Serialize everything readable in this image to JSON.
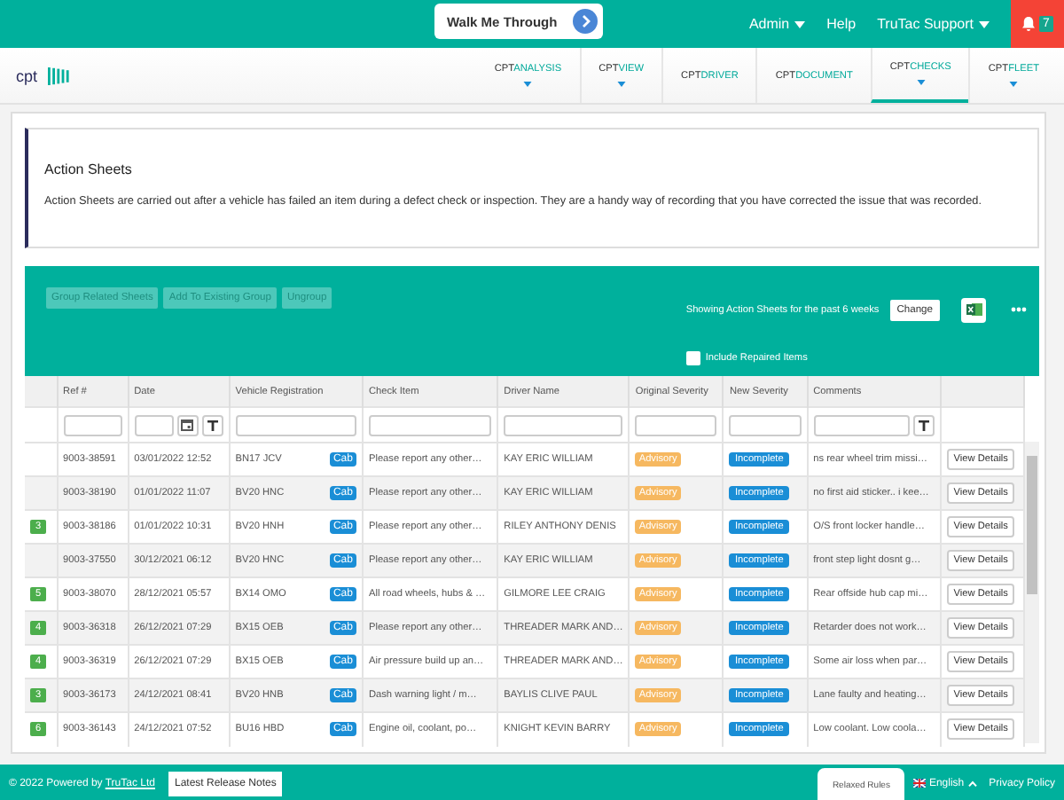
{
  "top_bar": {
    "tour_button": "Walk Me Through",
    "menus": [
      {
        "label": "Admin",
        "dropdown": true
      },
      {
        "label": "Help",
        "dropdown": false
      },
      {
        "label": "TruTac Support",
        "dropdown": true
      }
    ],
    "notifications": {
      "count": "7"
    }
  },
  "nav": {
    "logo": "cpt",
    "items": [
      {
        "prefix": "CPT",
        "name": "ANALYSIS",
        "dropdown": true,
        "selected": false
      },
      {
        "prefix": "CPT",
        "name": "VIEW",
        "dropdown": true,
        "selected": false
      },
      {
        "prefix": "CPT",
        "name": "DRIVER",
        "dropdown": false,
        "selected": false
      },
      {
        "prefix": "CPT",
        "name": "DOCUMENT",
        "dropdown": false,
        "selected": false
      },
      {
        "prefix": "CPT",
        "name": "CHECKS",
        "dropdown": true,
        "selected": true
      },
      {
        "prefix": "CPT",
        "name": "FLEET",
        "dropdown": true,
        "selected": false
      }
    ]
  },
  "info": {
    "title": "Action Sheets",
    "text": "Action Sheets are carried out after a vehicle has failed an item during a defect check or inspection. They are a handy way of recording that you have corrected the issue that was recorded."
  },
  "toolbar": {
    "buttons": [
      {
        "label": "Group Related Sheets",
        "disabled": true
      },
      {
        "label": "Add To Existing Group",
        "disabled": true
      },
      {
        "label": "Ungroup",
        "disabled": true
      }
    ],
    "period_text": "Showing Action Sheets for the past 6 weeks",
    "change_button": "Change",
    "include_repaired": {
      "label": "Include Repaired Items",
      "checked": false
    }
  },
  "table": {
    "columns": [
      {
        "kind": "blank"
      },
      {
        "label": "Ref #",
        "kind": "text"
      },
      {
        "label": "Date",
        "kind": "date"
      },
      {
        "label": "Vehicle Registration",
        "kind": "text"
      },
      {
        "label": "Check Item",
        "kind": "text"
      },
      {
        "label": "Driver Name",
        "kind": "text"
      },
      {
        "label": "Original Severity",
        "kind": "text"
      },
      {
        "label": "New Severity",
        "kind": "text"
      },
      {
        "label": "Comments",
        "kind": "textfilter"
      },
      {
        "kind": "blank"
      }
    ],
    "rows": [
      {
        "ref": "9003-38591",
        "date": "03/01/2022 12:52",
        "reg": "BN17 JCV",
        "body": "Cab",
        "check": "Please report any other…",
        "driver": "KAY ERIC WILLIAM",
        "original": "Advisory",
        "new": "Incomplete",
        "comments": "ns rear wheel trim missi…",
        "action": "View Details"
      },
      {
        "ref": "9003-38190",
        "date": "01/01/2022 11:07",
        "reg": "BV20 HNC",
        "body": "Cab",
        "check": "Please report any other…",
        "driver": "KAY ERIC WILLIAM",
        "original": "Advisory",
        "new": "Incomplete",
        "comments": "no first aid sticker.. i kee…",
        "action": "View Details"
      },
      {
        "group": "3",
        "ref": "9003-38186",
        "date": "01/01/2022 10:31",
        "reg": "BV20 HNH",
        "body": "Cab",
        "check": "Please report any other…",
        "driver": "RILEY ANTHONY DENIS",
        "original": "Advisory",
        "new": "Incomplete",
        "comments": "O/S front locker handle…",
        "action": "View Details"
      },
      {
        "ref": "9003-37550",
        "date": "30/12/2021 06:12",
        "reg": "BV20 HNC",
        "body": "Cab",
        "check": "Please report any other…",
        "driver": "KAY ERIC WILLIAM",
        "original": "Advisory",
        "new": "Incomplete",
        "comments": "front step light dosnt g…",
        "action": "View Details"
      },
      {
        "group": "5",
        "ref": "9003-38070",
        "date": "28/12/2021 05:57",
        "reg": "BX14 OMO",
        "body": "Cab",
        "check": "All road wheels, hubs & …",
        "driver": "GILMORE LEE CRAIG",
        "original": "Advisory",
        "new": "Incomplete",
        "comments": "Rear offside hub cap mi…",
        "action": "View Details"
      },
      {
        "group": "4",
        "ref": "9003-36318",
        "date": "26/12/2021 07:29",
        "reg": "BX15 OEB",
        "body": "Cab",
        "check": "Please report any other…",
        "driver": "THREADER MARK AND…",
        "original": "Advisory",
        "new": "Incomplete",
        "comments": "Retarder does not work…",
        "action": "View Details"
      },
      {
        "group": "4",
        "ref": "9003-36319",
        "date": "26/12/2021 07:29",
        "reg": "BX15 OEB",
        "body": "Cab",
        "check": "Air pressure build up an…",
        "driver": "THREADER MARK AND…",
        "original": "Advisory",
        "new": "Incomplete",
        "comments": "Some air loss when par…",
        "action": "View Details"
      },
      {
        "group": "3",
        "ref": "9003-36173",
        "date": "24/12/2021 08:41",
        "reg": "BV20 HNB",
        "body": "Cab",
        "check": "Dash warning light / m…",
        "driver": "BAYLIS CLIVE PAUL",
        "original": "Advisory",
        "new": "Incomplete",
        "comments": "Lane faulty and heating…",
        "action": "View Details"
      },
      {
        "group": "6",
        "ref": "9003-36143",
        "date": "24/12/2021 07:52",
        "reg": "BU16 HBD",
        "body": "Cab",
        "check": "Engine oil, coolant, po…",
        "driver": "KNIGHT KEVIN BARRY",
        "original": "Advisory",
        "new": "Incomplete",
        "comments": "Low coolant. Low coola…",
        "action": "View Details"
      }
    ]
  },
  "footer": {
    "copyright": "© 2022 Powered by ",
    "company_link": "TruTac Ltd",
    "release_notes": "Latest Release Notes",
    "relaxed_rules": "Relaxed Rules",
    "language": "English",
    "privacy": "Privacy Policy"
  }
}
